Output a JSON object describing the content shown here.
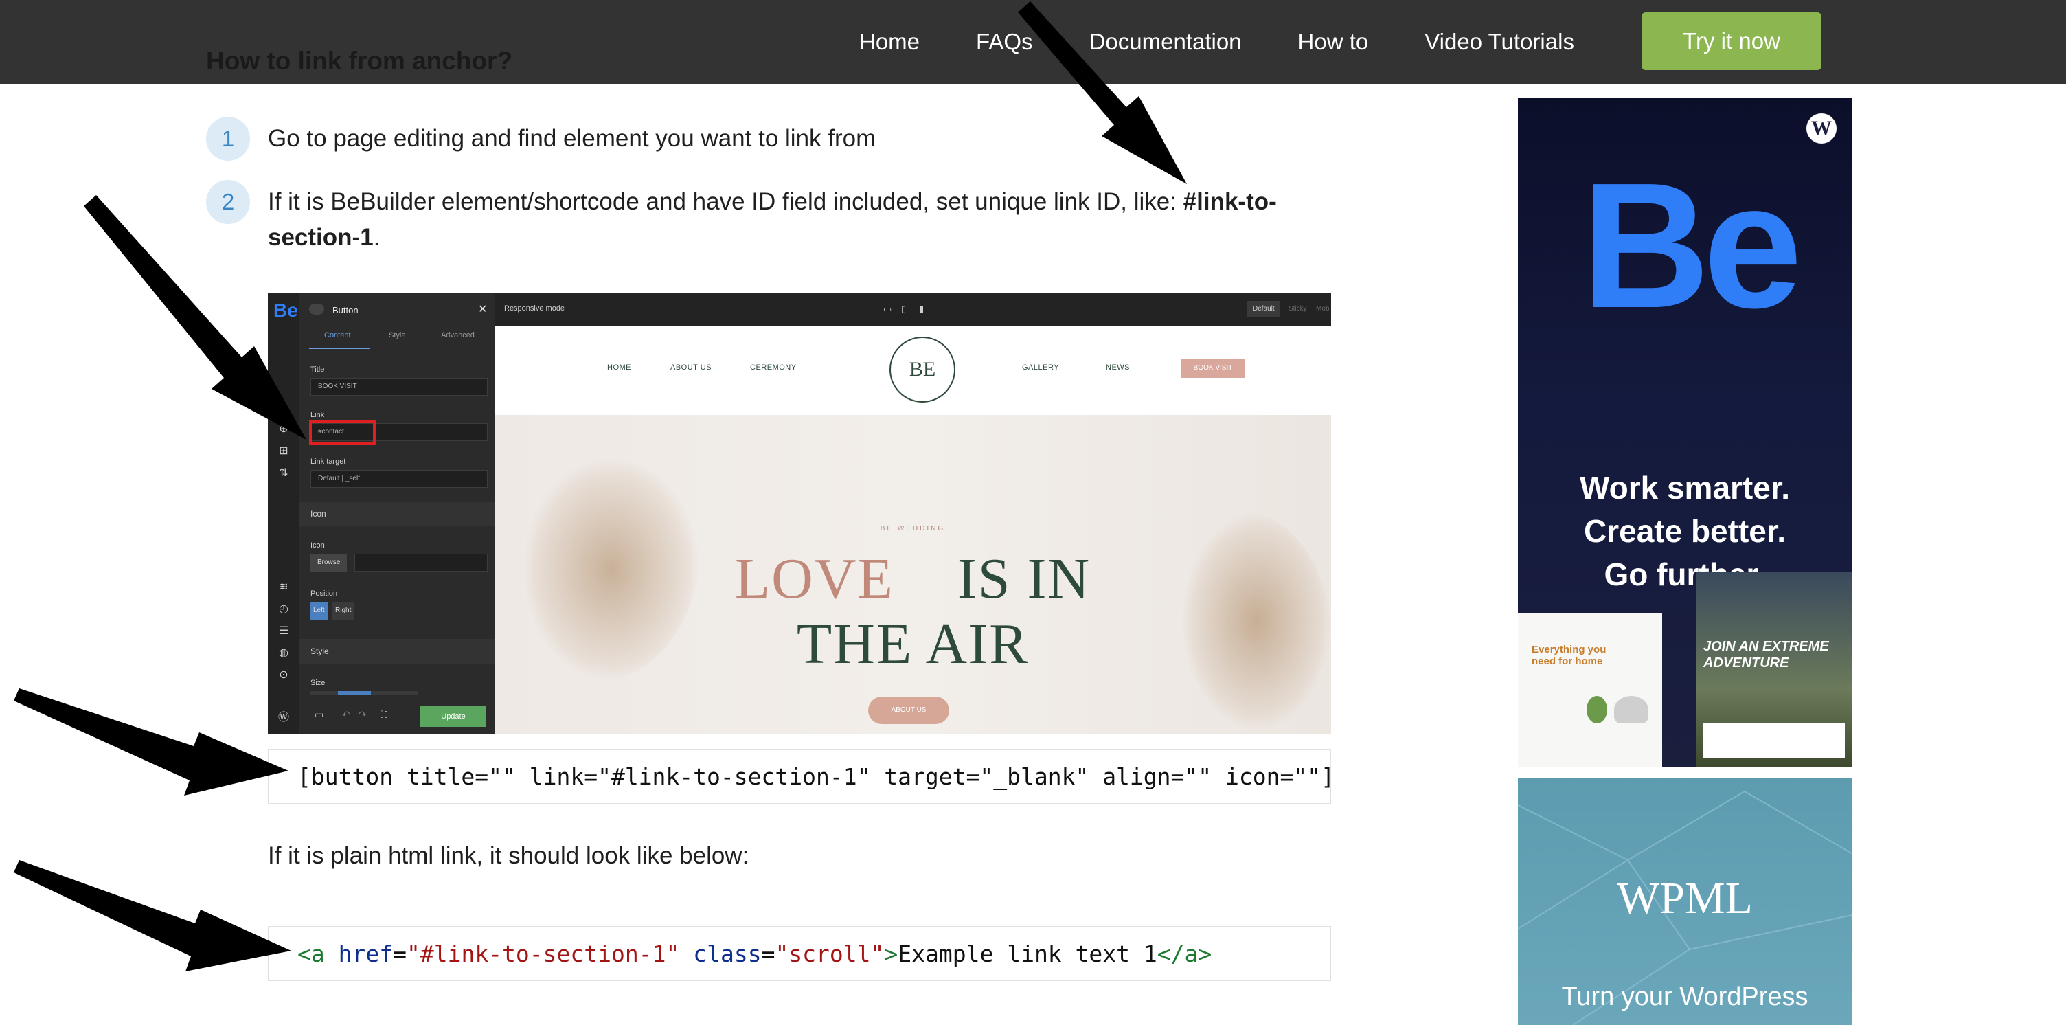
{
  "page": {
    "heading": "How to link from anchor?"
  },
  "nav": {
    "items": [
      "Home",
      "FAQs",
      "Documentation",
      "How to",
      "Video Tutorials"
    ],
    "cta": "Try it now"
  },
  "steps": [
    {
      "num": "1",
      "text": "Go to page editing and find element you want to link from"
    },
    {
      "num": "2",
      "text_before": "If it is BeBuilder element/shortcode and have ID field included, set unique link ID, like: ",
      "text_bold": "#link-to-section-1",
      "text_after": "."
    }
  ],
  "editor": {
    "logo": "Be",
    "panel_title": "Button",
    "tabs": [
      "Content",
      "Style",
      "Advanced"
    ],
    "title_label": "Title",
    "title_value": "BOOK VISIT",
    "link_label": "Link",
    "link_value": "#contact",
    "link_target_label": "Link target",
    "link_target_value": "Default | _self",
    "icon_section": "Icon",
    "icon_label": "Icon",
    "browse": "Browse",
    "position_label": "Position",
    "position_left": "Left",
    "position_right": "Right",
    "style_section": "Style",
    "size_label": "Size",
    "update": "Update",
    "responsive_mode": "Responsive mode",
    "modes": [
      "Default",
      "Sticky",
      "Mobile"
    ],
    "site_nav": [
      "HOME",
      "ABOUT US",
      "CEREMONY",
      "GALLERY",
      "NEWS"
    ],
    "site_logo": "BE",
    "site_book": "BOOK VISIT",
    "hero_kicker": "BE WEDDING",
    "hero_love": "LOVE",
    "hero_is_in": "IS IN",
    "hero_line2": "THE AIR",
    "hero_button": "ABOUT US"
  },
  "code1": {
    "text": "[button title=\"\" link=\"#link-to-section-1\" target=\"_blank\" align=\"\" icon=\"\"]"
  },
  "plain_note": "If it is plain html link, it should look like below:",
  "code2": {
    "open_tag": "<a",
    "attr_href": "href",
    "eq": "=",
    "val_href": "\"#link-to-section-1\"",
    "attr_class": "class",
    "val_class": "\"scroll\"",
    "close_open": ">",
    "link_text": "Example link text 1",
    "close_tag": "</a>"
  },
  "ads": {
    "be_logo": "Be",
    "be_lines": [
      "Work smarter.",
      "Create better.",
      "Go further."
    ],
    "be_shot1_text": "Everything you need for home",
    "be_shot2_text": "JOIN AN EXTREME ADVENTURE",
    "wp_glyph": "W",
    "wpml_logo": "WPML",
    "wpml_sub": "Turn your WordPress"
  },
  "colors": {
    "topbar": "#333333",
    "cta": "#8bb650",
    "step_badge": "#dcebf6",
    "step_badge_text": "#3a86c4",
    "be_blue": "#2f7df7",
    "wpml_bg": "#5d9bb0"
  }
}
